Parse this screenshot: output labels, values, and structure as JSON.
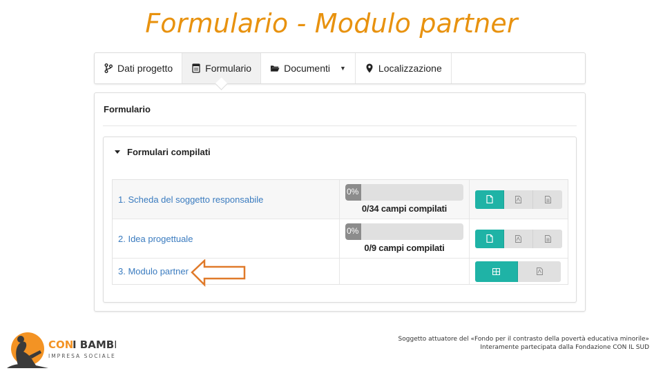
{
  "slide": {
    "title": "Formulario - Modulo partner"
  },
  "tabs": [
    {
      "label": "Dati progetto",
      "icon": "fork-icon"
    },
    {
      "label": "Formulario",
      "icon": "form-icon",
      "active": true
    },
    {
      "label": "Documenti",
      "icon": "folder-icon",
      "dropdown": true
    },
    {
      "label": "Localizzazione",
      "icon": "map-pin-icon"
    }
  ],
  "panel": {
    "title": "Formulario",
    "section_title": "Formulari compilati"
  },
  "forms": [
    {
      "label": "1. Scheda del soggetto responsabile",
      "percent_label": "0%",
      "fields": "0/34 campi compilati"
    },
    {
      "label": "2. Idea progettuale",
      "percent_label": "0%",
      "fields": "0/9 campi compilati"
    },
    {
      "label": "3. Modulo partner"
    }
  ],
  "logo": {
    "name": "CON I BAMBINI",
    "tagline": "IMPRESA SOCIALE"
  },
  "footer": {
    "line1": "Soggetto attuatore del «Fondo per il contrasto della povertà educativa minorile»",
    "line2": "Interamente partecipata dalla Fondazione CON IL SUD"
  },
  "colors": {
    "title": "#e8920f",
    "teal": "#1fb3a6",
    "link": "#3a7bbf",
    "arrow": "#e07a2a"
  }
}
